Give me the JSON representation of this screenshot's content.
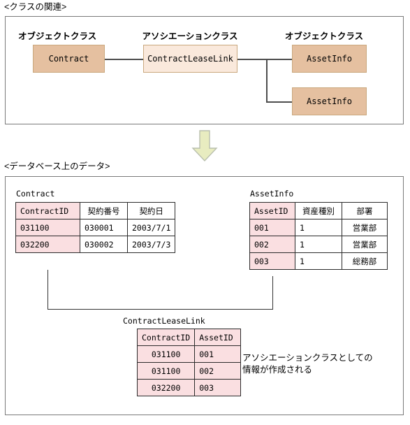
{
  "sections": {
    "class_relation": {
      "caption": "<クラスの関連>",
      "labels": {
        "object_class_left": "オブジェクトクラス",
        "association_class": "アソシエーションクラス",
        "object_class_right": "オブジェクトクラス"
      },
      "boxes": {
        "contract": "Contract",
        "contract_lease_link": "ContractLeaseLink",
        "asset_info_1": "AssetInfo",
        "asset_info_2": "AssetInfo"
      }
    },
    "database_data": {
      "caption": "<データベース上のデータ>",
      "note": "アソシエーションクラスとしての\n情報が作成される",
      "tables": {
        "contract": {
          "name": "Contract",
          "headers": [
            "ContractID",
            "契約番号",
            "契約日"
          ],
          "rows": [
            [
              "031100",
              "030001",
              "2003/7/1"
            ],
            [
              "032200",
              "030002",
              "2003/7/3"
            ]
          ]
        },
        "asset_info": {
          "name": "AssetInfo",
          "headers": [
            "AssetID",
            "資産種別",
            "部署"
          ],
          "rows": [
            [
              "001",
              "1",
              "営業部"
            ],
            [
              "002",
              "1",
              "営業部"
            ],
            [
              "003",
              "1",
              "総務部"
            ]
          ]
        },
        "contract_lease_link": {
          "name": "ContractLeaseLink",
          "headers": [
            "ContractID",
            "AssetID"
          ],
          "rows": [
            [
              "031100",
              "001"
            ],
            [
              "031100",
              "002"
            ],
            [
              "032200",
              "003"
            ]
          ]
        }
      }
    }
  },
  "colors": {
    "class_box_dark": "#e5c0a0",
    "class_box_light": "#fae9dc",
    "key_column": "#fadfe1",
    "arrow": "#e8ecc0",
    "frame_border": "#7a7a7a"
  }
}
